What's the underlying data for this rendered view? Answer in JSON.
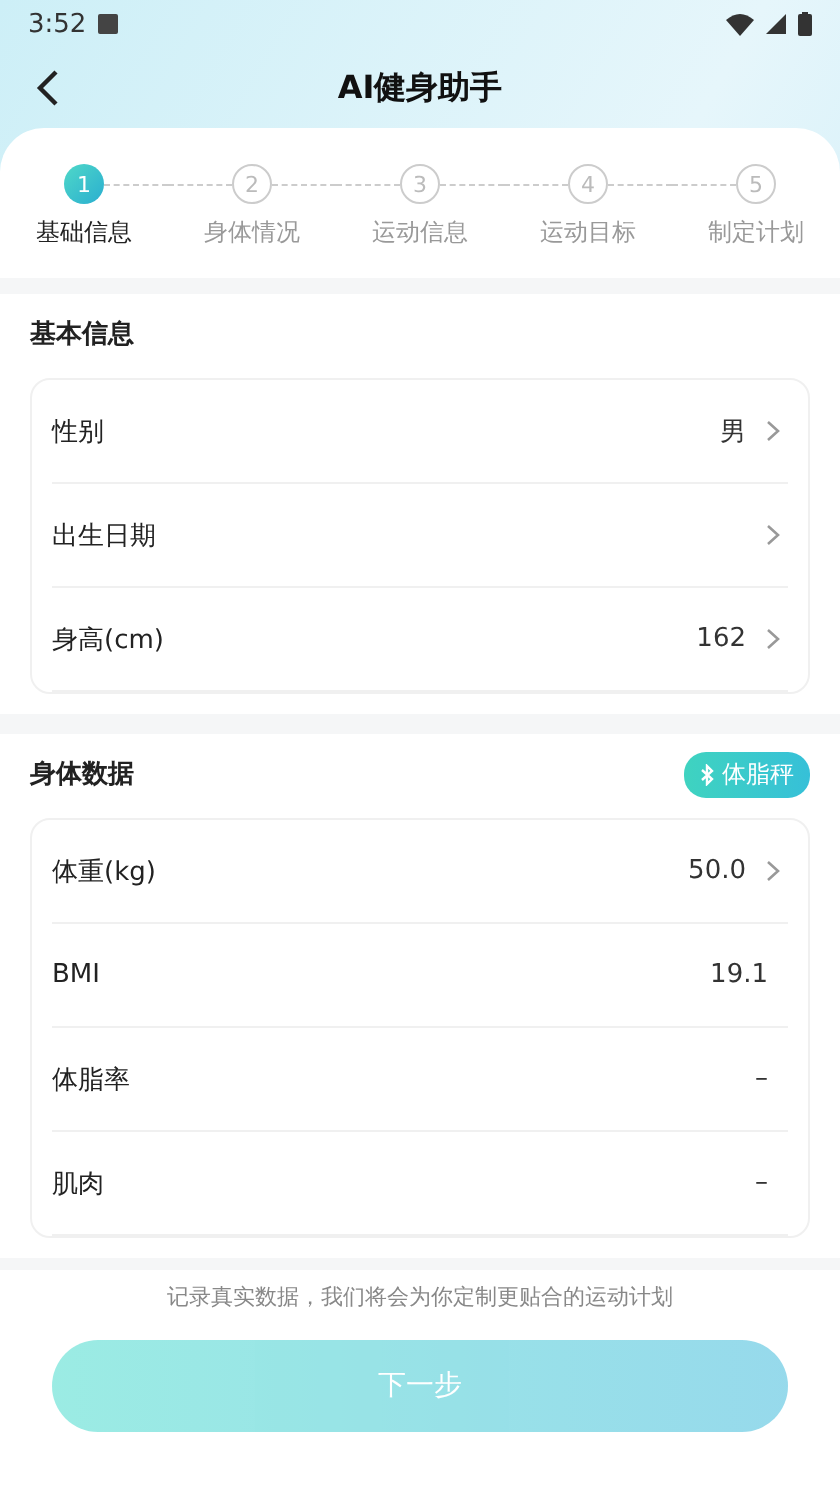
{
  "status_bar": {
    "time": "3:52"
  },
  "header": {
    "title": "AI健身助手"
  },
  "steps": [
    {
      "number": "1",
      "label": "基础信息",
      "selected": true
    },
    {
      "number": "2",
      "label": "身体情况",
      "selected": false
    },
    {
      "number": "3",
      "label": "运动信息",
      "selected": false
    },
    {
      "number": "4",
      "label": "运动目标",
      "selected": false
    },
    {
      "number": "5",
      "label": "制定计划",
      "selected": false
    }
  ],
  "sections": [
    {
      "title": "基本信息",
      "rows": [
        {
          "label": "性别",
          "value": "男",
          "arrow": true
        },
        {
          "label": "出生日期",
          "arrow": true
        },
        {
          "label": "身高(cm)",
          "value": "162",
          "arrow": true
        }
      ]
    },
    {
      "title": "身体数据",
      "badge": "体脂秤",
      "rows": [
        {
          "label": "体重(kg)",
          "value": "50.0",
          "arrow": true
        },
        {
          "label": "BMI",
          "value": "19.1",
          "arrow": false
        },
        {
          "label": "体脂率",
          "value": "–",
          "arrow": false
        },
        {
          "label": "肌肉",
          "value": "–",
          "arrow": false
        }
      ]
    }
  ],
  "footer": {
    "note": "记录真实数据，我们将会为你定制更贴合的运动计划",
    "button": {
      "label": "下一步",
      "disabled": true
    }
  }
}
